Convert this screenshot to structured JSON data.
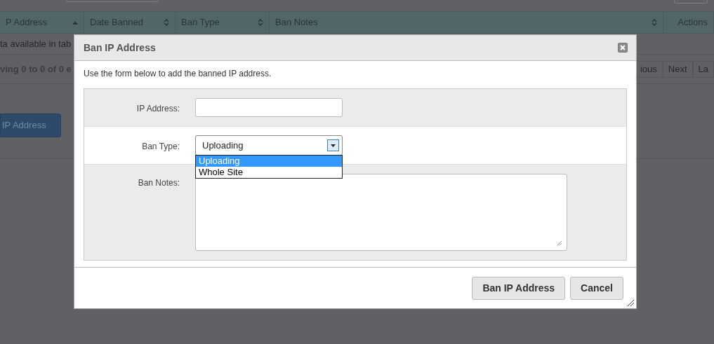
{
  "page": {
    "table": {
      "columns": [
        {
          "label": "P Address",
          "kind": "sorted"
        },
        {
          "label": "Date Banned",
          "kind": "sortable"
        },
        {
          "label": "Ban Type",
          "kind": "sortable"
        },
        {
          "label": "Ban Notes",
          "kind": "sortable"
        },
        {
          "label": "Actions",
          "kind": "plain"
        }
      ],
      "empty_message": "ta available in tab",
      "info": "ving 0 to 0 of 0 e",
      "pagination": [
        {
          "label": "ious",
          "disabled": true
        },
        {
          "label": "Next",
          "disabled": true
        },
        {
          "label": "La",
          "disabled": true
        }
      ]
    },
    "add_button": "IP Address"
  },
  "dialog": {
    "title": "Ban IP Address",
    "intro": "Use the form below to add the banned IP address.",
    "fields": [
      {
        "kind": "text",
        "label": "IP Address:"
      },
      {
        "kind": "select",
        "label": "Ban Type:",
        "value": "Uploading",
        "expanded": true,
        "options": [
          {
            "label": "Uploading",
            "selected": true
          },
          {
            "label": "Whole Site",
            "selected": false
          }
        ]
      },
      {
        "kind": "textarea",
        "label": "Ban Notes:"
      }
    ],
    "buttons": [
      "Ban IP Address",
      "Cancel"
    ]
  }
}
